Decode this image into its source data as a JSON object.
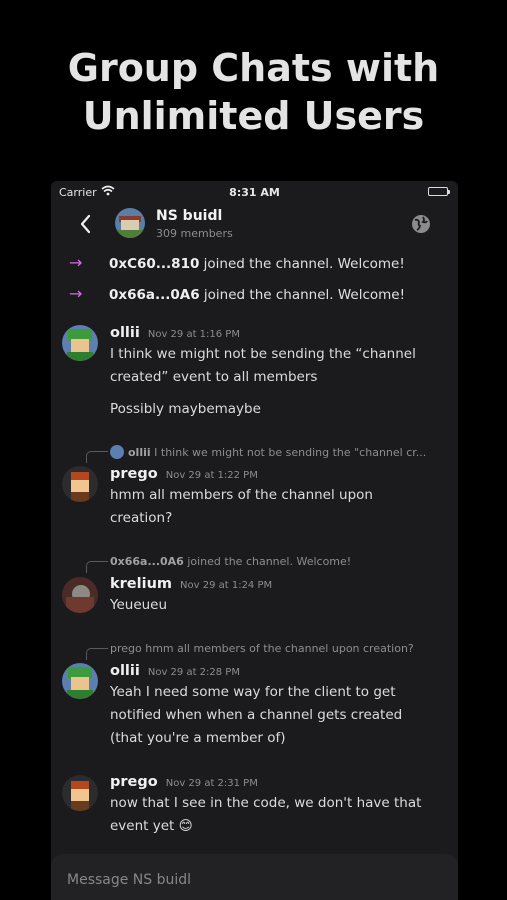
{
  "promo": {
    "line1": "Group Chats with",
    "line2": "Unlimited Users"
  },
  "status_bar": {
    "carrier": "Carrier",
    "time": "8:31 AM"
  },
  "header": {
    "channel_name": "NS buidl",
    "members": "309 members"
  },
  "system_messages": [
    {
      "address": "0xC60...810",
      "text": " joined the channel. Welcome!"
    },
    {
      "address": "0x66a...0A6",
      "text": " joined the channel. Welcome!"
    }
  ],
  "messages": [
    {
      "sender": "ollii",
      "time": "Nov 29 at 1:16 PM",
      "lines": [
        "I think we might not be sending the “channel",
        "created” event to all members"
      ],
      "extra": "Possibly maybemaybe"
    },
    {
      "reply_sender": "ollii",
      "reply_text": " I think we might not be sending the \"channel cr...",
      "sender": "prego",
      "time": "Nov 29 at 1:22 PM",
      "lines": [
        "hmm all members of the channel upon",
        "creation?"
      ]
    },
    {
      "reply_sender": "0x66a...0A6",
      "reply_text": " joined the channel. Welcome!",
      "sender": "krelium",
      "time": "Nov 29 at 1:24 PM",
      "lines": [
        "Yeueueu"
      ]
    },
    {
      "reply_text": "prego hmm all members of the channel upon creation?",
      "sender": "ollii",
      "time": "Nov 29 at 2:28 PM",
      "lines": [
        "Yeah I need some way for the client to get",
        "notified when when a channel gets created",
        "(that you're a member of)"
      ]
    },
    {
      "sender": "prego",
      "time": "Nov 29 at 2:31 PM",
      "lines": [
        "now that I see in the code, we don't have that",
        "event yet 😊"
      ]
    }
  ],
  "composer": {
    "placeholder": "Message NS buidl"
  }
}
